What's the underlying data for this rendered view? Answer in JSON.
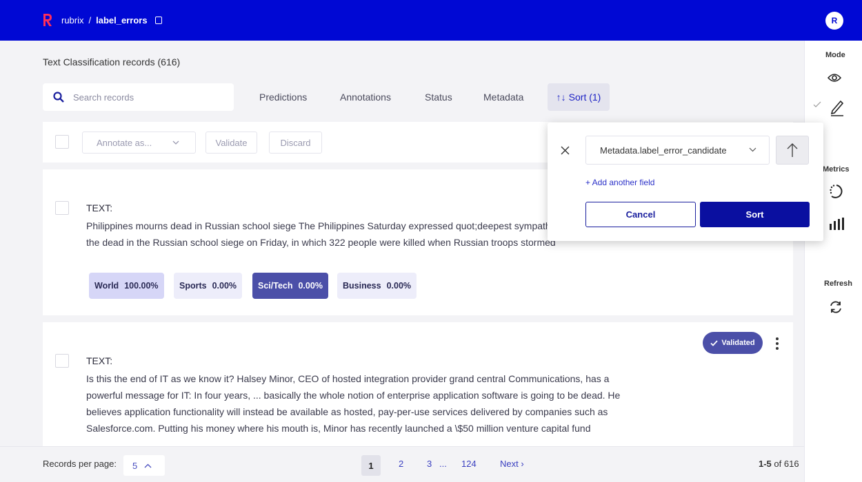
{
  "topbar": {
    "app": "rubrix",
    "separator": "/",
    "dataset": "label_errors",
    "avatar": "R"
  },
  "sidebar": {
    "mode_label": "Mode",
    "metrics_label": "Metrics",
    "refresh_label": "Refresh"
  },
  "main": {
    "title": "Text Classification records (616)"
  },
  "search": {
    "placeholder": "Search records"
  },
  "filters": {
    "predictions": "Predictions",
    "annotations": "Annotations",
    "status": "Status",
    "metadata": "Metadata",
    "sort": "Sort (1)"
  },
  "bulk": {
    "annotate": "Annotate as...",
    "validate": "Validate",
    "discard": "Discard"
  },
  "records": [
    {
      "label": "TEXT:",
      "text": "Philippines mourns dead in Russian school siege The Philippines Saturday expressed quot;deepest sympathies to the families of the dead in the Russian school siege on Friday, in which 322 people were killed when Russian troops stormed",
      "predictions": [
        {
          "name": "World",
          "score": "100.00%"
        },
        {
          "name": "Sports",
          "score": "0.00%"
        },
        {
          "name": "Sci/Tech",
          "score": "0.00%"
        },
        {
          "name": "Business",
          "score": "0.00%"
        }
      ]
    },
    {
      "label": "TEXT:",
      "status": "Validated",
      "text": "Is this the end of IT as we know it? Halsey Minor, CEO of hosted integration provider grand central Communications, has a powerful message for IT: In four years, ... basically the whole notion of enterprise application software is going to be dead. He believes application functionality will instead be available as hosted, pay-per-use services delivered by companies such as Salesforce.com. Putting his money where his mouth is, Minor has recently launched a \\$50 million venture capital fund"
    }
  ],
  "sort_popover": {
    "field": "Metadata.label_error_candidate",
    "add_field": "+ Add another field",
    "cancel": "Cancel",
    "sort": "Sort"
  },
  "footer": {
    "records_per_page_label": "Records per page:",
    "records_per_page": "5",
    "pages": [
      "1",
      "2",
      "3"
    ],
    "ellipsis": "...",
    "last_page": "124",
    "next": "Next ›",
    "range": "1-5",
    "range_suffix": "of 616"
  },
  "colors": {
    "brand": "#0008d4",
    "accent": "#4b4fa8",
    "button_dark": "#0a0fa0"
  }
}
